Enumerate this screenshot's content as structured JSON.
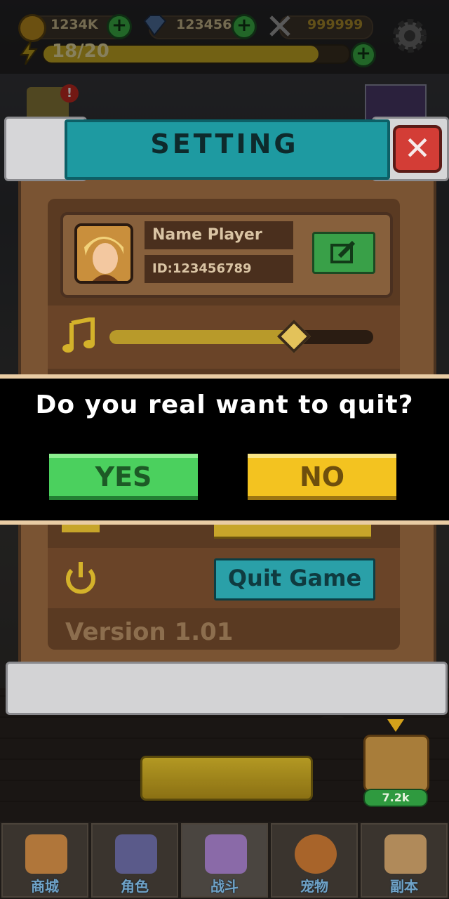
{
  "hud": {
    "gold": "1234K",
    "gems": "123456",
    "power": "999999",
    "energy": "18/20",
    "energy_fraction": 0.9
  },
  "settings": {
    "title": "SETTING",
    "player_name": "Name Player",
    "player_id": "ID:123456789",
    "music_volume_fraction": 0.7,
    "quit_label": "Quit Game",
    "version": "Version 1.01"
  },
  "confirm": {
    "question": "Do you real want to quit?",
    "yes_label": "YES",
    "no_label": "NO"
  },
  "bottom": {
    "chest_value": "7.2k"
  },
  "nav": {
    "items": [
      {
        "label": "商城"
      },
      {
        "label": "角色"
      },
      {
        "label": "战斗"
      },
      {
        "label": "宠物"
      },
      {
        "label": "副本"
      }
    ]
  },
  "colors": {
    "yes_green": "#4bd05e",
    "no_yellow": "#f3c320",
    "title_teal": "#1e9aa1",
    "panel_brown": "#7a5433"
  }
}
